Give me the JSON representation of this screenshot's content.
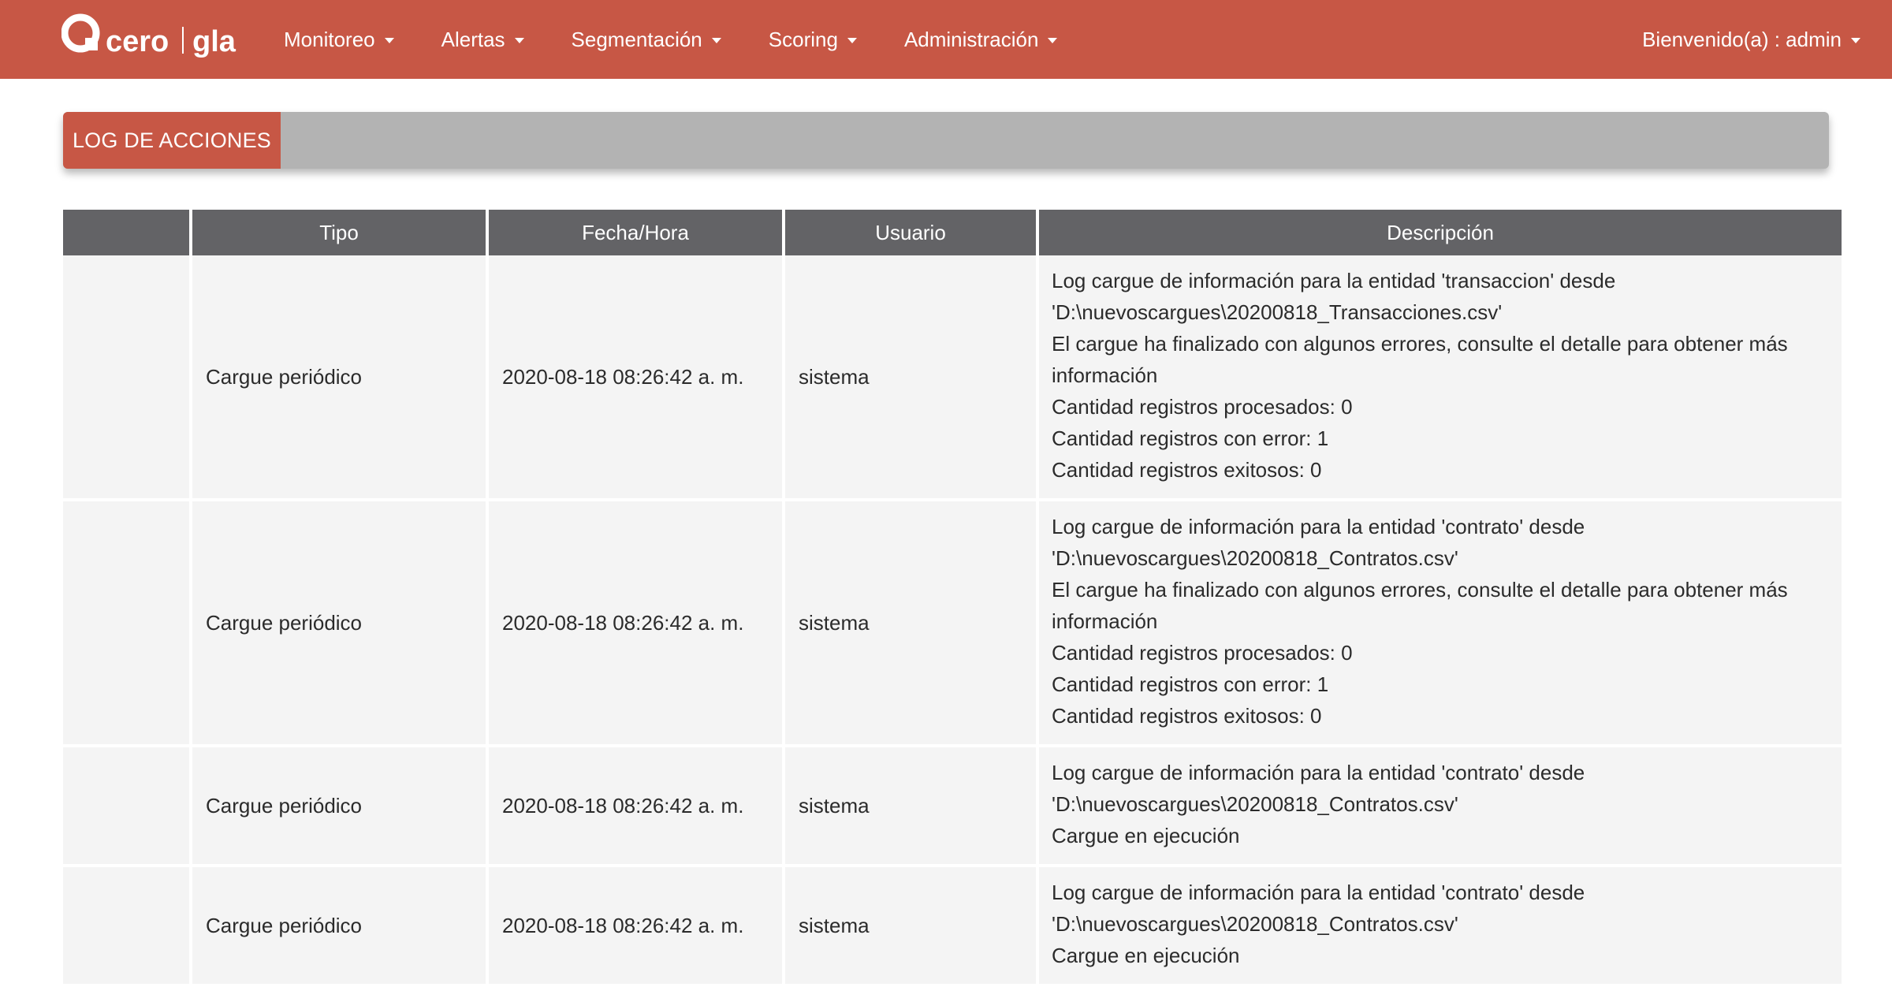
{
  "brand": {
    "logo_text_left": "cero",
    "logo_text_right": "gla"
  },
  "nav": {
    "items": [
      {
        "label": "Monitoreo"
      },
      {
        "label": "Alertas"
      },
      {
        "label": "Segmentación"
      },
      {
        "label": "Scoring"
      },
      {
        "label": "Administración"
      }
    ],
    "user_label": "Bienvenido(a) : admin"
  },
  "section": {
    "title": "LOG DE ACCIONES"
  },
  "table": {
    "headers": [
      "",
      "Tipo",
      "Fecha/Hora",
      "Usuario",
      "Descripción"
    ],
    "rows": [
      {
        "tipo": "Cargue periódico",
        "fecha": "2020-08-18 08:26:42 a. m.",
        "usuario": "sistema",
        "descripcion": [
          "Log cargue de información para la entidad 'transaccion' desde",
          "'D:\\nuevoscargues\\20200818_Transacciones.csv'",
          "El cargue ha finalizado con algunos errores, consulte el detalle para obtener más",
          "información",
          "Cantidad registros procesados: 0",
          "Cantidad registros con error: 1",
          "Cantidad registros exitosos: 0"
        ]
      },
      {
        "tipo": "Cargue periódico",
        "fecha": "2020-08-18 08:26:42 a. m.",
        "usuario": "sistema",
        "descripcion": [
          "Log cargue de información para la entidad 'contrato' desde",
          "'D:\\nuevoscargues\\20200818_Contratos.csv'",
          "El cargue ha finalizado con algunos errores, consulte el detalle para obtener más",
          "información",
          "Cantidad registros procesados: 0",
          "Cantidad registros con error: 1",
          "Cantidad registros exitosos: 0"
        ]
      },
      {
        "tipo": "Cargue periódico",
        "fecha": "2020-08-18 08:26:42 a. m.",
        "usuario": "sistema",
        "descripcion": [
          "Log cargue de información para la entidad 'contrato' desde",
          "'D:\\nuevoscargues\\20200818_Contratos.csv'",
          "Cargue en ejecución"
        ]
      },
      {
        "tipo": "Cargue periódico",
        "fecha": "2020-08-18 08:26:42 a. m.",
        "usuario": "sistema",
        "descripcion": [
          "Log cargue de información para la entidad 'contrato' desde",
          "'D:\\nuevoscargues\\20200818_Contratos.csv'",
          "Cargue en ejecución"
        ]
      }
    ]
  },
  "colors": {
    "brand": "#c75745",
    "header_bg": "#636366",
    "section_bar": "#b3b3b3",
    "row_bg": "#f4f4f4"
  }
}
